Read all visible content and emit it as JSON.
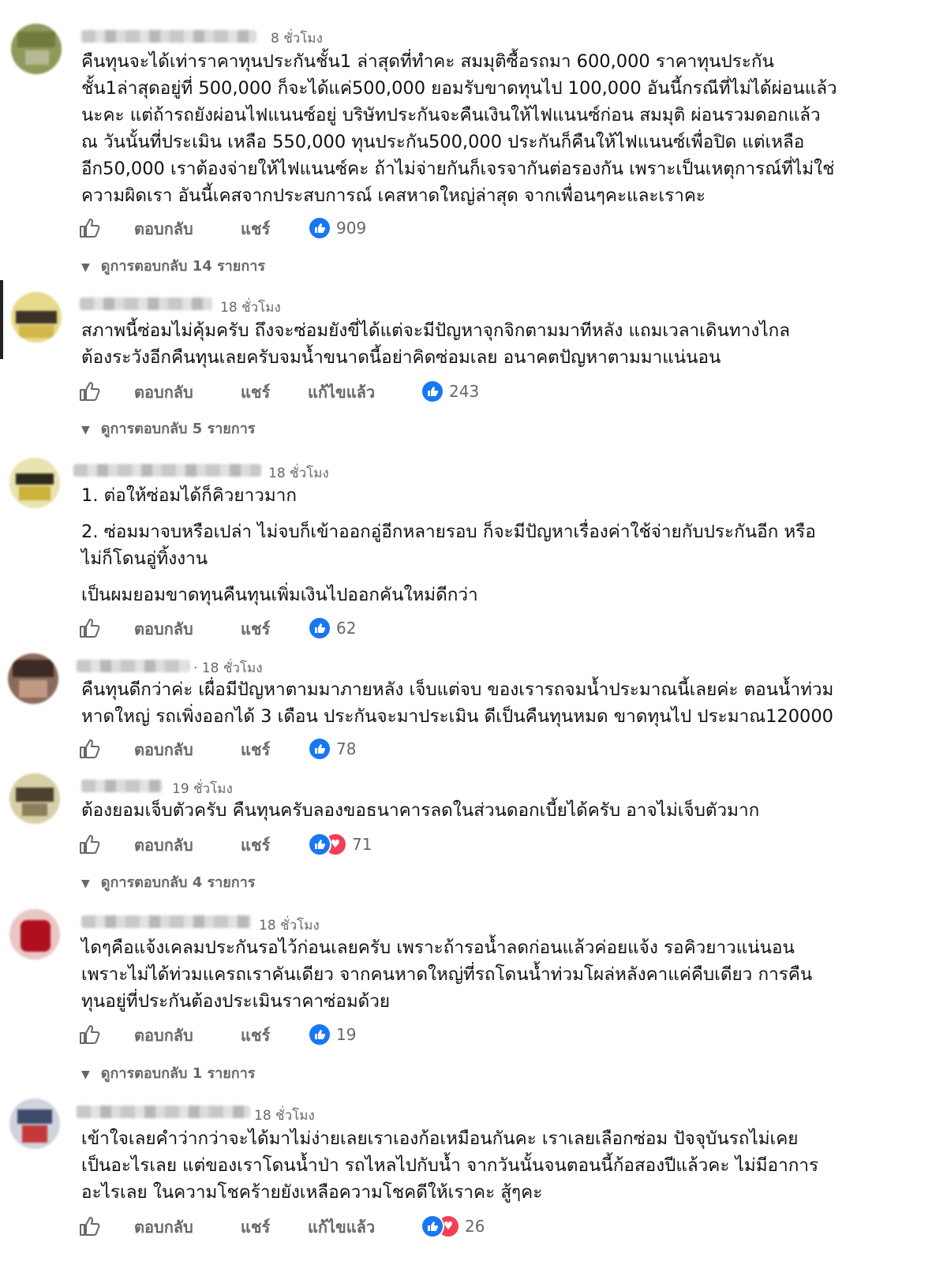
{
  "actions": {
    "reply_label": "ตอบกลับ",
    "share_label": "แชร์",
    "edited_label": "แก้ไขแล้ว"
  },
  "comments": [
    {
      "time": "8 ชั่วโมง",
      "lines": [
        "คืนทุนจะได้เท่าราคาทุนประกันชั้น1 ล่าสุดที่ทำคะ สมมุติซื้อรถมา 600,000 ราคาทุนประกัน",
        "ชั้น1ล่าสุดอยู่ที่ 500,000 ก็จะได้แค่500,000 ยอมรับขาดทุนไป 100,000 อันนี้กรณีที่ไม่ได้ผ่อนแล้ว",
        "นะคะ แต่ถ้ารถยังผ่อนไฟแนนซ์อยู่ บริษัทประกันจะคืนเงินให้ไฟแนนซ์ก่อน สมมุติ ผ่อนรวมดอกแล้ว",
        "ณ วันนั้นที่ประเมิน เหลือ 550,000 ทุนประกัน500,000 ประกันก็คืนให้ไฟแนนซ์เพื่อปิด แต่เหลือ",
        "อีก50,000 เราต้องจ่ายให้ไฟแนนซ์คะ ถ้าไม่จ่ายกันก็เจรจากันต่อรองกัน เพราะเป็นเหตุการณ์ที่ไม่ใช่",
        "ความผิดเรา อันนี้เคสจากประสบการณ์ เคสหาดใหญ่ล่าสุด จากเพื่อนๆคะและเราคะ"
      ],
      "reaction_count": "909",
      "replies_label": "ดูการตอบกลับ 14 รายการ"
    },
    {
      "time": "18 ชั่วโมง",
      "lines": [
        "สภาพนี้ซ่อมไม่คุ้มครับ ถึงจะซ่อมยังขี่ได้แต่จะมีปัญหาจุกจิกตามมาทีหลัง แถมเวลาเดินทางไกล",
        "ต้องระวังอีกคืนทุนเลยครับจมน้ำขนาดนี้อย่าคิดซ่อมเลย อนาคตปัญหาตามมาแน่นอน"
      ],
      "reaction_count": "243",
      "replies_label": "ดูการตอบกลับ 5 รายการ"
    },
    {
      "time": "18 ชั่วโมง",
      "lines": [
        "1. ต่อให้ซ่อมได้ก็คิวยาวมาก",
        "2. ซ่อมมาจบหรือเปล่า ไม่จบก็เข้าออกอู่อีกหลายรอบ ก็จะมีปัญหาเรื่องค่าใช้จ่ายกับประกันอีก หรือ",
        "ไม่ก็โดนอู่ทิ้งงาน",
        "เป็นผมยอมขาดทุนคืนทุนเพิ่มเงินไปออกคันใหม่ดีกว่า"
      ],
      "reaction_count": "62"
    },
    {
      "time": "· 18 ชั่วโมง",
      "lines": [
        "คืนทุนดีกว่าค่ะ เผื่อมีปัญหาตามมาภายหลัง เจ็บแต่จบ ของเรารถจมน้ำประมาณนี้เลยค่ะ ตอนน้ำท่วม",
        "หาดใหญ่ รถเพิ่งออกได้ 3 เดือน ประกันจะมาประเมิน ดีเป็นคืนทุนหมด ขาดทุนไป ประมาณ120000"
      ],
      "reaction_count": "78"
    },
    {
      "time": "19 ชั่วโมง",
      "lines": [
        "ต้องยอมเจ็บตัวครับ คืนทุนครับลองขอธนาคารลดในส่วนดอกเบี้ยได้ครับ อาจไม่เจ็บตัวมาก"
      ],
      "reaction_count": "71",
      "replies_label": "ดูการตอบกลับ 4 รายการ"
    },
    {
      "time": "18 ชั่วโมง",
      "lines": [
        "ไดๆคือแจ้งเคลมประกันรอไว้ก่อนเลยครับ เพราะถ้ารอน้ำลดก่อนแล้วค่อยแจ้ง รอคิวยาวแน่นอน",
        "เพราะไม่ได้ท่วมแครถเราคันเดียว จากคนหาดใหญ่ที่รถโดนน้ำท่วมโผล่หลังคาแค่คืบเดียว การคืน",
        "ทุนอยู่ที่ประกันต้องประเมินราคาซ่อมด้วย"
      ],
      "reaction_count": "19",
      "replies_label": "ดูการตอบกลับ 1 รายการ"
    },
    {
      "time": "18 ชั่วโมง",
      "lines": [
        "เข้าใจเลยคำว่ากว่าจะได้มาไม่ง่ายเลยเราเองก้อเหมือนกันคะ เราเลยเลือกซ่อม ปัจจุบันรถไม่เคย",
        "เป็นอะไรเลย แต่ของเราโดนน้ำป่า รถไหลไปกับน้ำ จากวันนั้นจนตอนนี้ก้อสองปีแล้วคะ ไม่มีอาการ",
        "อะไรเลย ในความโชคร้ายยังเหลือความโชคดีให้เราคะ สู้ๆคะ"
      ],
      "reaction_count": "26"
    }
  ],
  "colors": {
    "like": "#1877f2",
    "heart": "#f33e58",
    "meta": "#65676b"
  }
}
